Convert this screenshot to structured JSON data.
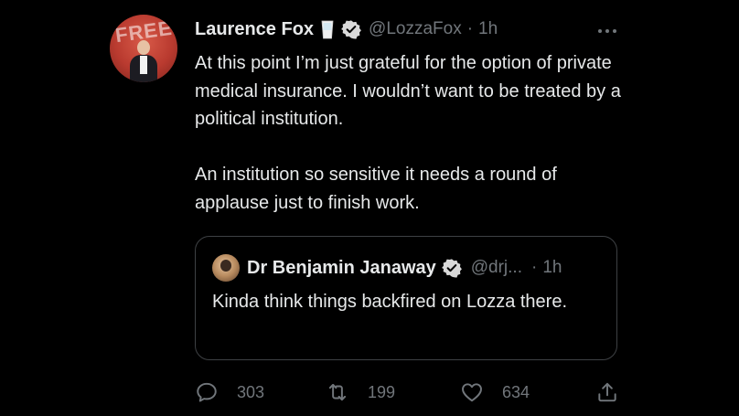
{
  "tweet": {
    "author": {
      "display_name": "Laurence Fox",
      "handle": "@LozzaFox",
      "time": "1h",
      "avatar_text": "FREE",
      "badges": [
        "cup-icon",
        "verified-icon"
      ]
    },
    "paragraphs": [
      "At this point I’m just grateful for the option of private medical insurance. I wouldn’t want to be treated by a political institution.",
      "An institution so sensitive it needs a round of applause just to finish work."
    ],
    "quote": {
      "display_name": "Dr Benjamin Janaway",
      "handle": "@drj...",
      "time": "1h",
      "text": "Kinda think things backfired on Lozza there."
    },
    "actions": {
      "reply_count": "303",
      "retweet_count": "199",
      "like_count": "634"
    },
    "separator": "·",
    "colors": {
      "background": "#000000",
      "text": "#e7e9ea",
      "muted": "#71767b",
      "border": "#3e4144"
    }
  }
}
